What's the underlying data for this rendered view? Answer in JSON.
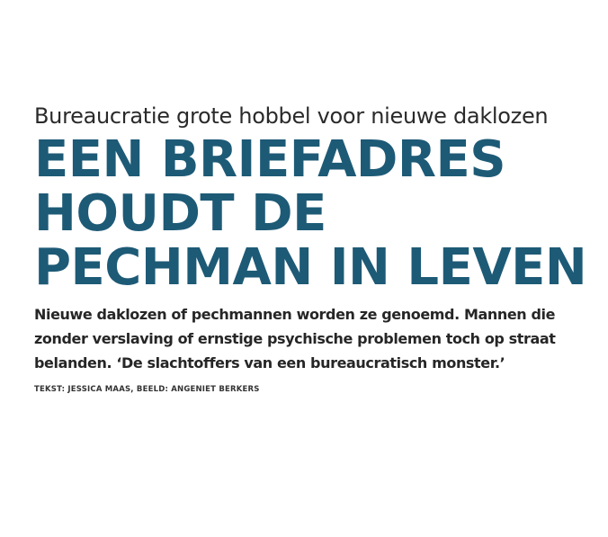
{
  "article": {
    "kicker": "Bureaucratie grote hobbel voor nieuwe daklozen",
    "headline_lines": [
      "EEN BRIEFADRES",
      "HOUDT DE",
      "PECHMAN IN LEVEN"
    ],
    "intro": "Nieuwe daklozen of pechmannen worden ze genoemd. Mannen die zonder verslaving of ernstige psychische problemen toch op straat belanden. ‘De slachtoffers van een bureaucratisch monster.’",
    "credits": "TEKST: JESSICA MAAS, BEELD: ANGENIET BERKERS"
  },
  "colors": {
    "headline": "#1d5a76",
    "body_text": "#262626"
  }
}
